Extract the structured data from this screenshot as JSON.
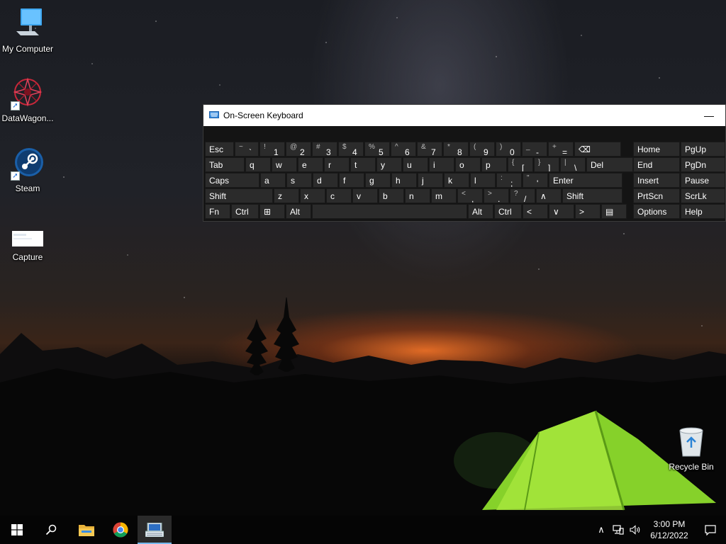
{
  "desktop": {
    "icons": [
      {
        "label": "My Computer",
        "icon": "computer-icon"
      },
      {
        "label": "DataWagon...",
        "icon": "datawagon-icon"
      },
      {
        "label": "Steam",
        "icon": "steam-icon"
      },
      {
        "label": "Capture",
        "icon": "image-file-icon"
      },
      {
        "label": "Recycle Bin",
        "icon": "recycle-bin-icon"
      }
    ]
  },
  "osk": {
    "title": "On-Screen Keyboard",
    "minimize_glyph": "—",
    "rows": [
      [
        {
          "main": "Esc"
        },
        {
          "sub": "~",
          "main": "`"
        },
        {
          "sub": "!",
          "main": "1"
        },
        {
          "sub": "@",
          "main": "2"
        },
        {
          "sub": "#",
          "main": "3"
        },
        {
          "sub": "$",
          "main": "4"
        },
        {
          "sub": "%",
          "main": "5"
        },
        {
          "sub": "^",
          "main": "6"
        },
        {
          "sub": "&",
          "main": "7"
        },
        {
          "sub": "*",
          "main": "8"
        },
        {
          "sub": "(",
          "main": "9"
        },
        {
          "sub": ")",
          "main": "0"
        },
        {
          "sub": "_",
          "main": "-"
        },
        {
          "sub": "+",
          "main": "="
        },
        {
          "main": "⌫"
        }
      ],
      [
        {
          "main": "Tab"
        },
        {
          "main": "q"
        },
        {
          "main": "w"
        },
        {
          "main": "e"
        },
        {
          "main": "r"
        },
        {
          "main": "t"
        },
        {
          "main": "y"
        },
        {
          "main": "u"
        },
        {
          "main": "i"
        },
        {
          "main": "o"
        },
        {
          "main": "p"
        },
        {
          "sub": "{",
          "main": "["
        },
        {
          "sub": "}",
          "main": "]"
        },
        {
          "sub": "|",
          "main": "\\"
        },
        {
          "main": "Del"
        }
      ],
      [
        {
          "main": "Caps"
        },
        {
          "main": "a"
        },
        {
          "main": "s"
        },
        {
          "main": "d"
        },
        {
          "main": "f"
        },
        {
          "main": "g"
        },
        {
          "main": "h"
        },
        {
          "main": "j"
        },
        {
          "main": "k"
        },
        {
          "main": "l"
        },
        {
          "sub": ":",
          "main": ";"
        },
        {
          "sub": "\"",
          "main": "'"
        },
        {
          "main": "Enter"
        }
      ],
      [
        {
          "main": "Shift"
        },
        {
          "main": "z"
        },
        {
          "main": "x"
        },
        {
          "main": "c"
        },
        {
          "main": "v"
        },
        {
          "main": "b"
        },
        {
          "main": "n"
        },
        {
          "main": "m"
        },
        {
          "sub": "<",
          "main": ","
        },
        {
          "sub": ">",
          "main": "."
        },
        {
          "sub": "?",
          "main": "/"
        },
        {
          "main": "∧"
        },
        {
          "main": "Shift"
        }
      ],
      [
        {
          "main": "Fn"
        },
        {
          "main": "Ctrl"
        },
        {
          "main": "⊞"
        },
        {
          "main": "Alt"
        },
        {
          "main": ""
        },
        {
          "main": "Alt"
        },
        {
          "main": "Ctrl"
        },
        {
          "main": "<"
        },
        {
          "main": "∨"
        },
        {
          "main": ">"
        },
        {
          "main": "▤"
        }
      ]
    ],
    "nav_keys": [
      [
        "Home",
        "PgUp"
      ],
      [
        "End",
        "PgDn"
      ],
      [
        "Insert",
        "Pause"
      ],
      [
        "PrtScn",
        "ScrLk"
      ],
      [
        "Options",
        "Help"
      ]
    ]
  },
  "taskbar": {
    "start_icon": "windows-start-icon",
    "search_icon": "search-icon",
    "apps": [
      {
        "name": "file-explorer-icon"
      },
      {
        "name": "chrome-icon"
      },
      {
        "name": "on-screen-keyboard-icon",
        "active": true
      }
    ],
    "tray": {
      "chevron": "∧",
      "time": "3:00 PM",
      "date": "6/12/2022"
    }
  }
}
